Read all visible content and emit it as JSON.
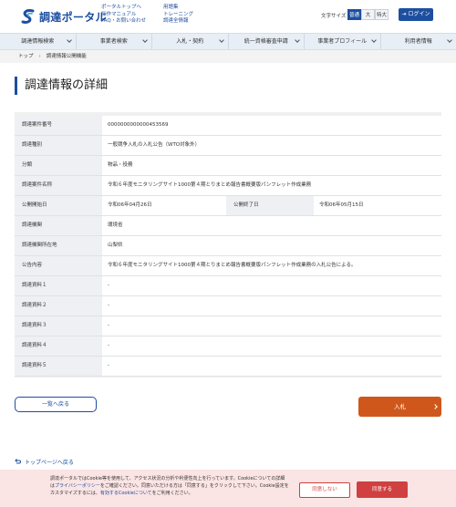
{
  "header": {
    "logo_text": "調達ポータル",
    "links_col1": [
      "ポータルトップへ",
      "操作マニュアル",
      "FAQ・お問い合わせ"
    ],
    "links_col2": [
      "用語集",
      "トレーニング",
      "調達全情報"
    ],
    "font_size_label": "文字サイズ",
    "font_sizes": [
      "普通",
      "大",
      "特大"
    ],
    "login_label": "ログイン"
  },
  "nav": {
    "items": [
      "調達情報検索",
      "事業者検索",
      "入札・契約",
      "統一資格審査申請",
      "事業者プロフィール",
      "利用者情報"
    ]
  },
  "breadcrumb": {
    "home": "トップ",
    "current": "調達情報公開機能"
  },
  "page_title": "調達情報の詳細",
  "details": {
    "rows": [
      {
        "label": "調達案件番号",
        "value": "0000000000000453569"
      },
      {
        "label": "調達種別",
        "value": "一般競争入札の入札公告（WTO対象外）"
      },
      {
        "label": "分類",
        "value": "物品・役務"
      },
      {
        "label": "調達案件名称",
        "value": "令和６年度モニタリングサイト1000第４期とりまとめ報告書概要版パンフレット作成業務"
      }
    ],
    "date_row": {
      "label1": "公開開始日",
      "value1": "令和06年04月26日",
      "label2": "公開終了日",
      "value2": "令和06年05月15日"
    },
    "rows2": [
      {
        "label": "調達機関",
        "value": "環境省"
      },
      {
        "label": "調達機関所在地",
        "value": "山梨県"
      },
      {
        "label": "公告内容",
        "value": "令和６年度モニタリングサイト1000第４期とりまとめ報告書概要版パンフレット作成業務の入札公告による。"
      },
      {
        "label": "調達資料１",
        "value": "-"
      },
      {
        "label": "調達資料２",
        "value": "-"
      },
      {
        "label": "調達資料３",
        "value": "-"
      },
      {
        "label": "調達資料４",
        "value": "-"
      },
      {
        "label": "調達資料５",
        "value": "-"
      }
    ]
  },
  "buttons": {
    "back": "一覧へ戻る",
    "bid": "入札"
  },
  "top_link": "トップページへ戻る",
  "cookie": {
    "text_part1": "調達ポータルではCookie等を使用して、アクセス状況の分析や利便性向上を行っています。Cookieについての詳細は",
    "privacy_link": "プライバシーポリシー",
    "text_part2": "をご確認ください。同意いただける方は「同意する」をクリックして下さい。Cookie設定をカスタマイズするには、",
    "settings_link": "有効するCookieについて",
    "text_part3": "をご利用ください。",
    "deny": "同意しない",
    "agree": "同意する"
  },
  "colors": {
    "brand": "#1d4fa0",
    "bid_button": "#d0571c",
    "cookie_bg": "#fbe4e4",
    "cookie_accent": "#d04040"
  }
}
